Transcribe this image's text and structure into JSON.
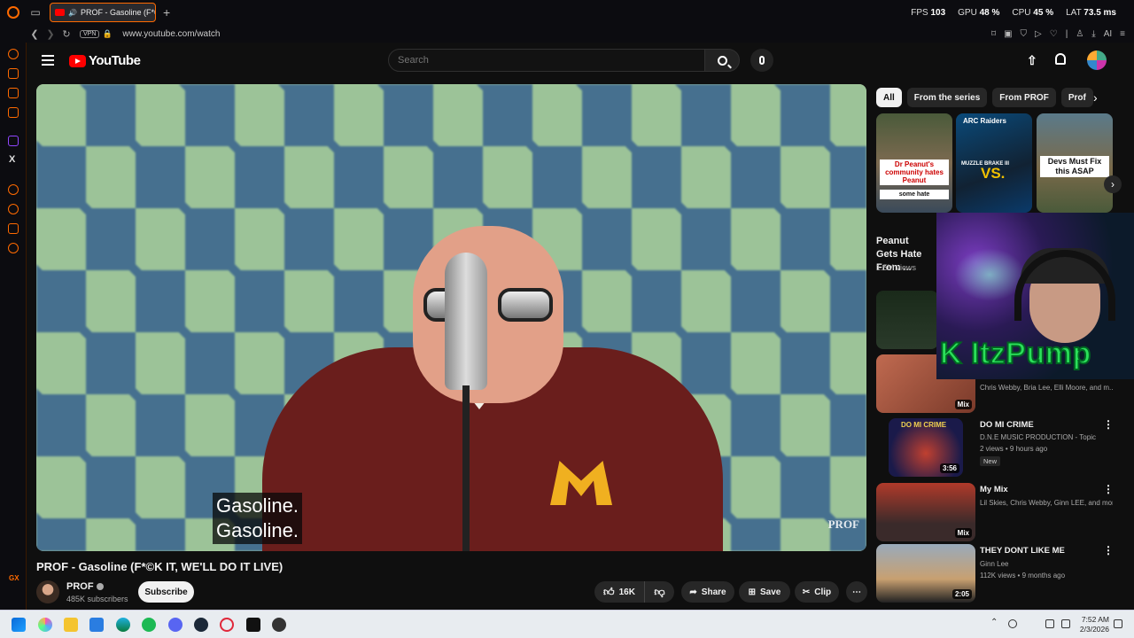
{
  "browser": {
    "tab_title": "PROF - Gasoline (F*©",
    "add_tab": "+",
    "url": "www.youtube.com/watch",
    "vpn": "VPN",
    "stats": {
      "fps_label": "FPS",
      "fps_value": "103",
      "gpu_label": "GPU",
      "gpu_value": "48 %",
      "cpu_label": "CPU",
      "cpu_value": "45 %",
      "lat_label": "LAT",
      "lat_value": "73.5 ms"
    },
    "sidebar_gx": "GX"
  },
  "header": {
    "logo_text": "YouTube",
    "search_placeholder": "Search"
  },
  "player": {
    "caption_line1": "Gasoline.",
    "caption_line2": "Gasoline.",
    "watermark": "PROF"
  },
  "video": {
    "title": "PROF - Gasoline (F*©K IT, WE'LL DO IT LIVE)",
    "channel": "PROF",
    "subscribers": "485K subscribers",
    "subscribe_label": "Subscribe",
    "likes": "16K",
    "share_label": "Share",
    "save_label": "Save",
    "clip_label": "Clip"
  },
  "chips": [
    "All",
    "From the series",
    "From PROF",
    "Prof"
  ],
  "shelf": {
    "title": "Peanut Gets Hate From ...",
    "views": "1.5M views",
    "thumb1_text": "Dr Peanut's community hates Peanut",
    "thumb1_sub": "some hate",
    "thumb2_text": "ARC Raiders",
    "thumb2_label": "MUZZLE BRAKE III",
    "thumb2_vs": "VS.",
    "thumb3_text": "Devs Must Fix this ASAP"
  },
  "webcam": {
    "name": "ItzPump"
  },
  "sidebar_videos": [
    {
      "title": "",
      "meta1": "Chris Webby, Bria Lee, Elli Moore, and m...",
      "meta2": "",
      "badge": "Mix",
      "new": ""
    },
    {
      "title": "DO MI CRIME",
      "meta1": "D.N.E MUSIC PRODUCTION - Topic",
      "meta2": "2 views • 9 hours ago",
      "badge": "3:56",
      "new": "New",
      "thumb_text": "DO MI CRIME"
    },
    {
      "title": "My Mix",
      "meta1": "Lil Skies, Chris Webby, Ginn LEE, and more",
      "meta2": "",
      "badge": "Mix",
      "new": ""
    },
    {
      "title": "THEY DONT LIKE ME",
      "meta1": "Ginn Lee",
      "meta2": "112K views • 9 months ago",
      "badge": "2:05",
      "new": ""
    }
  ],
  "taskbar": {
    "time": "7:52 AM",
    "date": "2/3/2026"
  }
}
